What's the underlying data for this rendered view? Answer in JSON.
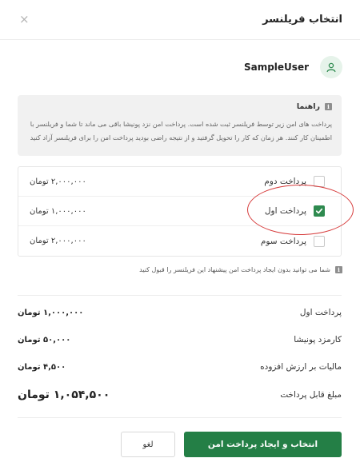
{
  "header": {
    "title": "انتخاب فریلنسر",
    "close_icon": "×"
  },
  "user": {
    "name": "SampleUser",
    "avatar_icon": "user-icon"
  },
  "guide": {
    "title": "راهنما",
    "info_glyph": "i",
    "line1": "پرداخت های امن زیر توسط فریلنسر ثبت شده است. پرداخت امن نزد پونیشا باقی می ماند تا شما و فریلنسر با",
    "line2": "اطمینان کار کنند. هر زمان که کار را تحویل گرفتید و از نتیجه راضی بودید پرداخت امن را برای فریلنسر آزاد کنید"
  },
  "payments": [
    {
      "label": "پرداخت دوم",
      "amount": "۲,۰۰۰,۰۰۰ تومان",
      "checked": false
    },
    {
      "label": "پرداخت اول",
      "amount": "۱,۰۰۰,۰۰۰ تومان",
      "checked": true
    },
    {
      "label": "پرداخت سوم",
      "amount": "۲,۰۰۰,۰۰۰ تومان",
      "checked": false
    }
  ],
  "note": "شما می توانید بدون ایجاد پرداخت امن پیشنهاد این فریلنسر را قبول کنید",
  "summary": [
    {
      "label": "پرداخت اول",
      "value": "۱,۰۰۰,۰۰۰ تومان"
    },
    {
      "label": "کارمزد پونیشا",
      "value": "۵۰,۰۰۰ تومان"
    },
    {
      "label": "مالیات بر ارزش افزوده",
      "value": "۴,۵۰۰ تومان"
    }
  ],
  "total": {
    "label": "مبلغ قابل پرداخت",
    "value": "۱,۰۵۴,۵۰۰ تومان"
  },
  "buttons": {
    "primary": "انتخاب و ایجاد پرداخت امن",
    "cancel": "لغو"
  },
  "colors": {
    "accent": "#247f46",
    "highlight": "#d63a3a"
  }
}
